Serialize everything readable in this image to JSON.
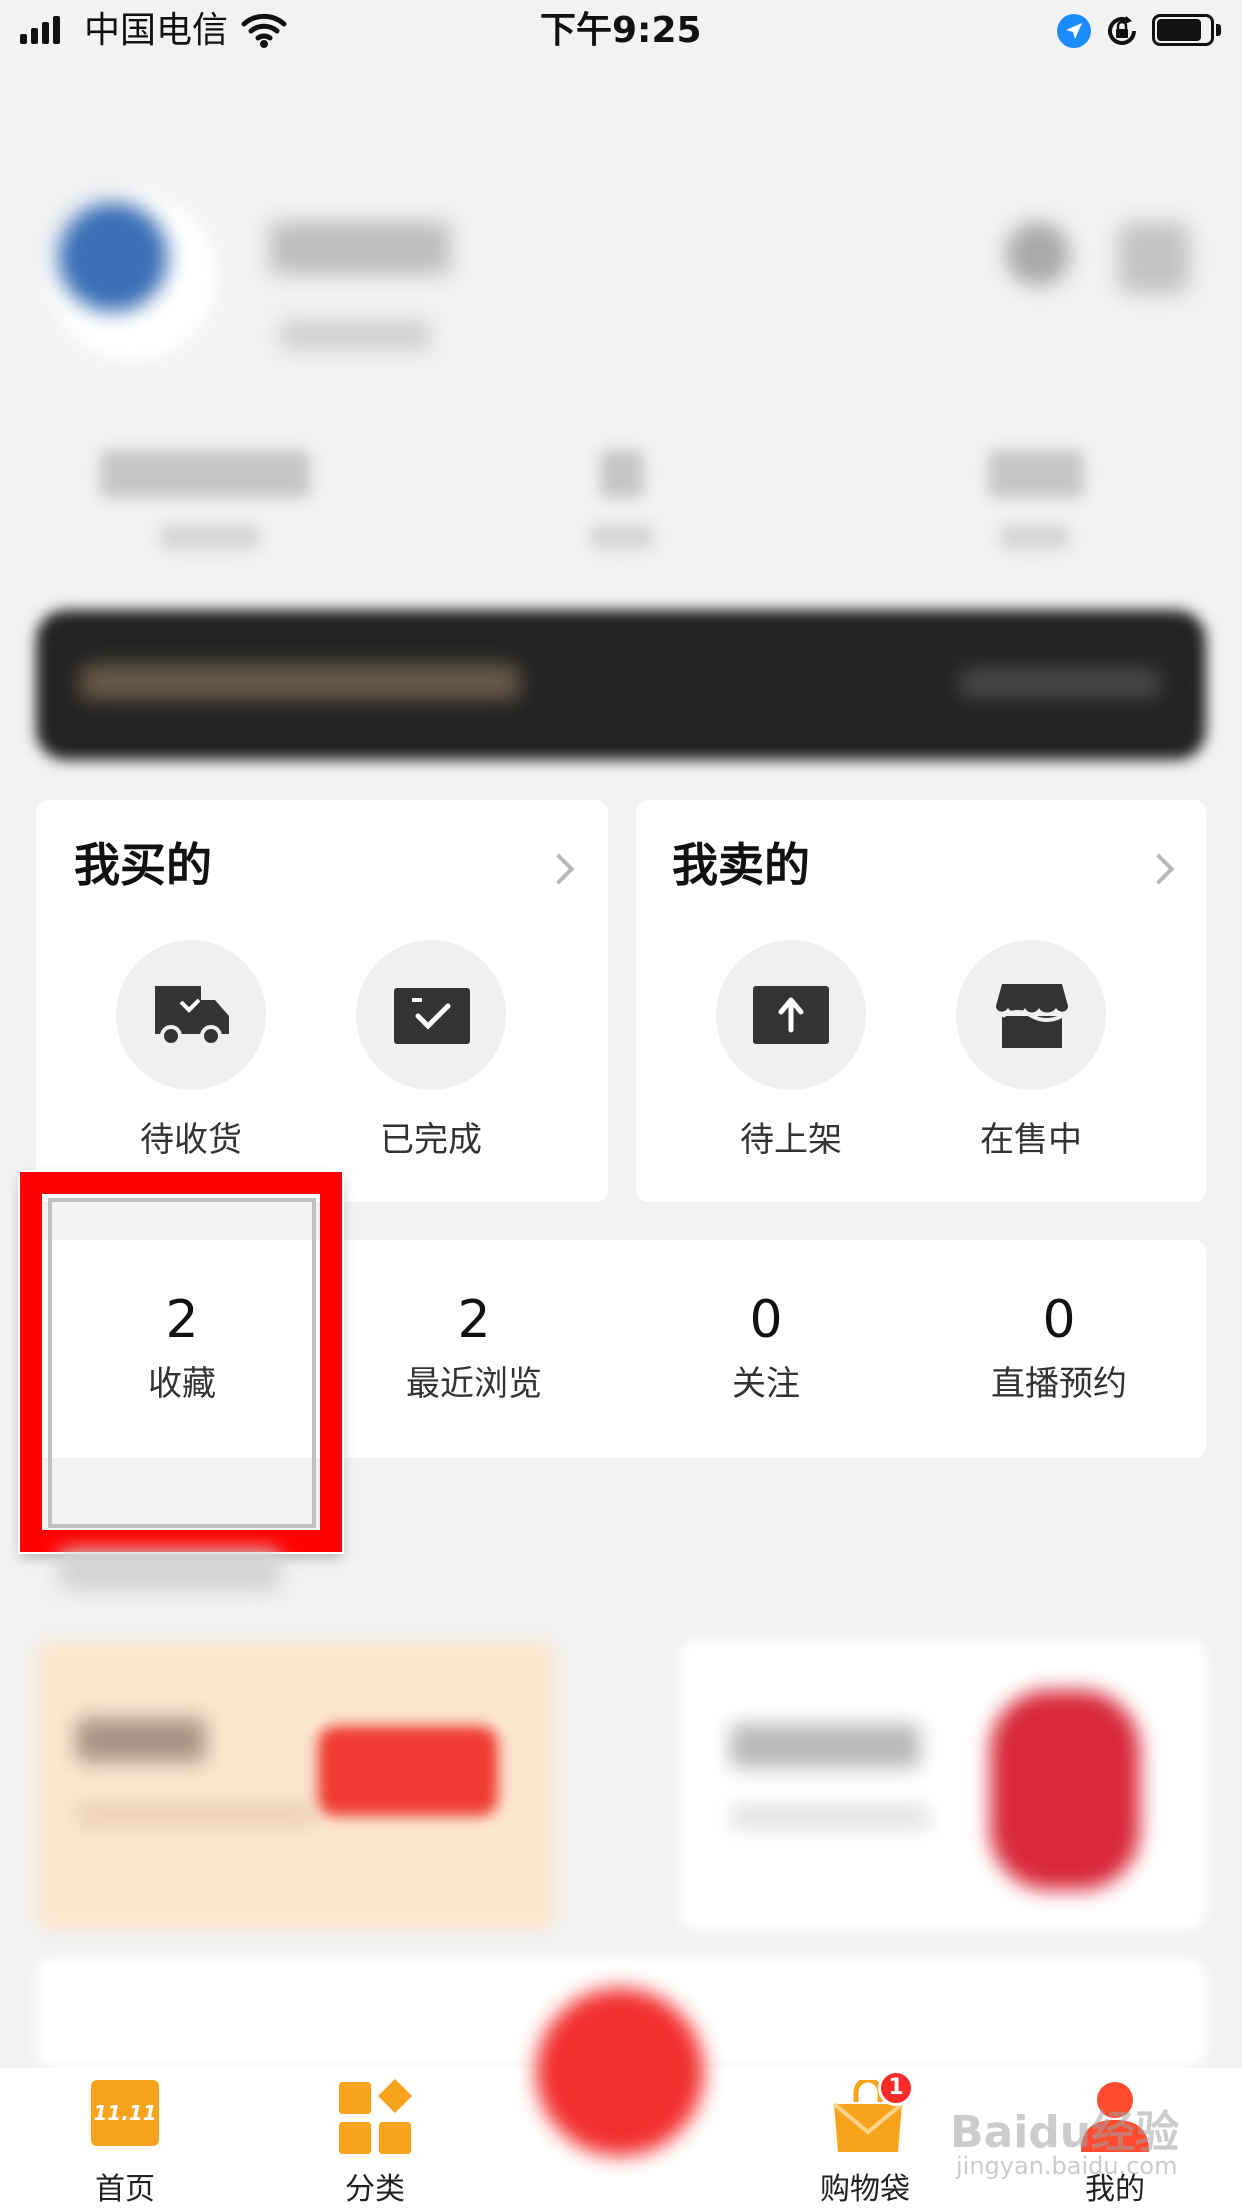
{
  "status_bar": {
    "carrier": "中国电信",
    "time": "下午9:25",
    "battery_level": 0.85,
    "icons": [
      "signal-icon",
      "wifi-icon",
      "location-icon",
      "rotation-lock-icon",
      "battery-icon"
    ]
  },
  "buying": {
    "title": "我买的",
    "items": [
      {
        "label": "待收货",
        "icon": "delivery-truck-icon"
      },
      {
        "label": "已完成",
        "icon": "completed-box-icon"
      }
    ]
  },
  "selling": {
    "title": "我卖的",
    "items": [
      {
        "label": "待上架",
        "icon": "upload-icon"
      },
      {
        "label": "在售中",
        "icon": "storefront-icon"
      }
    ]
  },
  "stats": [
    {
      "value": "2",
      "label": "收藏"
    },
    {
      "value": "2",
      "label": "最近浏览"
    },
    {
      "value": "0",
      "label": "关注"
    },
    {
      "value": "0",
      "label": "直播预约"
    }
  ],
  "tab_bar": {
    "home_badge": "11.11",
    "tabs": [
      {
        "label": "首页",
        "icon": "home-1111-icon"
      },
      {
        "label": "分类",
        "icon": "category-grid-icon"
      },
      {
        "label": "",
        "icon": "publish-center-icon"
      },
      {
        "label": "购物袋",
        "icon": "shopping-bag-icon",
        "badge": "1"
      },
      {
        "label": "我的",
        "icon": "profile-icon"
      }
    ]
  },
  "watermark": {
    "main": "Baidu经验",
    "sub": "jingyan.baidu.com"
  },
  "colors": {
    "highlight": "#ff0000",
    "accent": "#ff3b30",
    "orange": "#f7a31b",
    "background": "#f2f2f2"
  }
}
